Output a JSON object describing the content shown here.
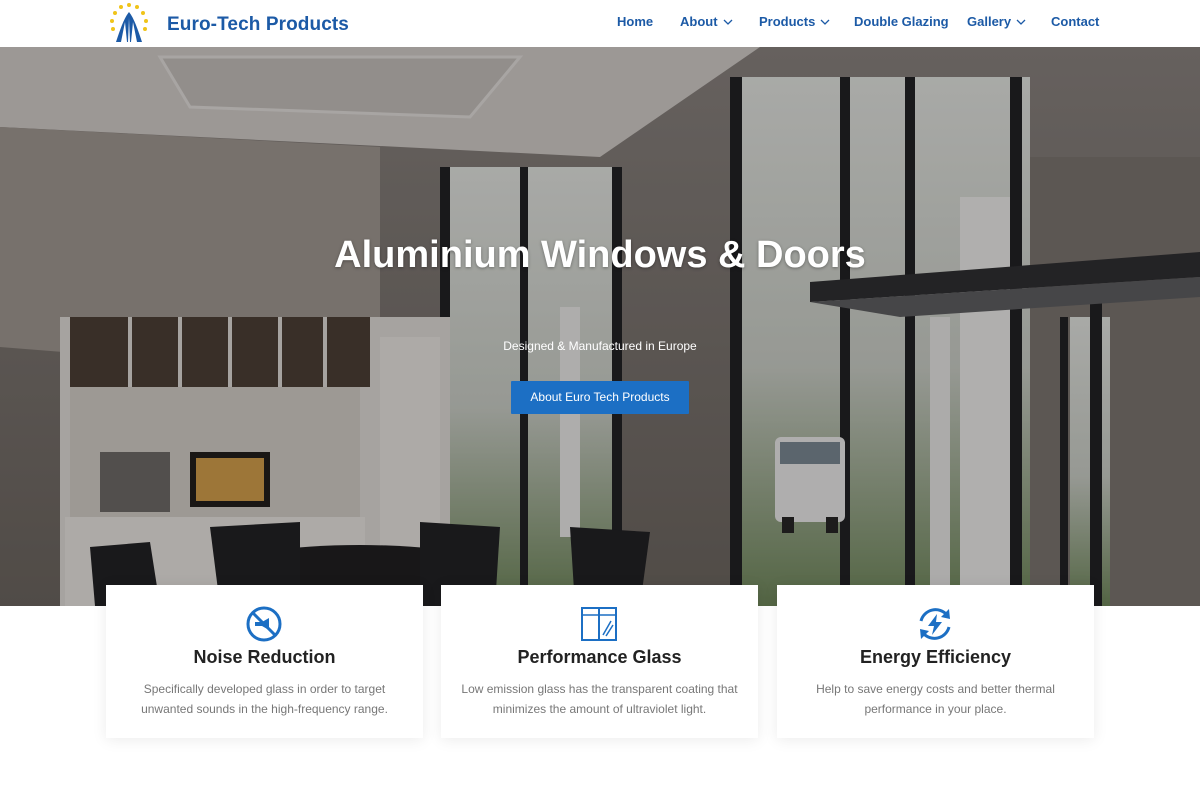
{
  "brand": {
    "name": "Euro-Tech Products",
    "logo_icon": "logo-emblem-icon"
  },
  "nav": {
    "items": [
      {
        "label": "Home",
        "has_dropdown": false
      },
      {
        "label": "About",
        "has_dropdown": true
      },
      {
        "label": "Products",
        "has_dropdown": true
      },
      {
        "label": "Double Glazing",
        "has_dropdown": false
      },
      {
        "label": "Gallery",
        "has_dropdown": true
      },
      {
        "label": "Contact",
        "has_dropdown": false
      }
    ]
  },
  "hero": {
    "title": "Aluminium Windows & Doors",
    "subtitle": "Designed & Manufactured in Europe",
    "button_label": "About Euro Tech Products"
  },
  "features": [
    {
      "icon": "no-noise-icon",
      "title": "Noise Reduction",
      "text": "Specifically developed glass in order to target unwanted sounds in the high-frequency range."
    },
    {
      "icon": "window-glass-icon",
      "title": "Performance Glass",
      "text": "Low emission glass has the transparent coating that minimizes the amount of ultraviolet light."
    },
    {
      "icon": "energy-cycle-icon",
      "title": "Energy Efficiency",
      "text": "Help to save energy costs and better thermal performance in your place."
    }
  ],
  "colors": {
    "brand_blue": "#1c5aa6",
    "button_blue": "#1c6fc4",
    "icon_blue": "#1c6fc4",
    "card_title": "#222222",
    "card_text": "#777777"
  }
}
